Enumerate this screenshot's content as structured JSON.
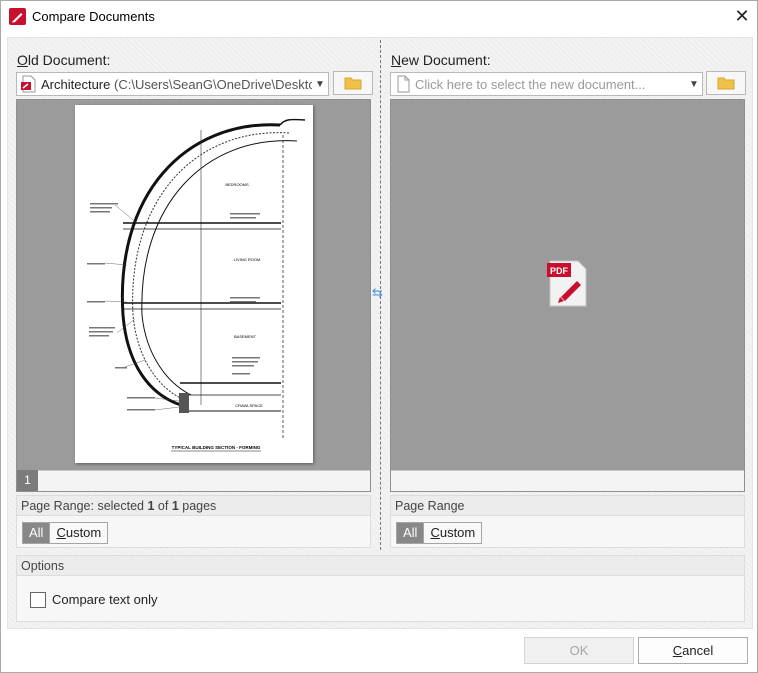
{
  "window": {
    "title": "Compare Documents"
  },
  "old_doc": {
    "label_pre": "O",
    "label_rest": "ld Document:",
    "file_name": "Architecture",
    "file_path": "(C:\\Users\\SeanG\\OneDrive\\Desktop\\W",
    "page_number": "1",
    "range_prefix": "Page Range: selected ",
    "range_selected": "1",
    "range_of": " of ",
    "range_total": "1",
    "range_suffix": " pages",
    "all_label": "All",
    "custom_pre": "C",
    "custom_rest": "ustom"
  },
  "new_doc": {
    "label_pre": "N",
    "label_rest": "ew Document:",
    "placeholder": "Click here to select the new document...",
    "range_label": "Page Range",
    "all_label": "All",
    "custom_pre": "C",
    "custom_rest": "ustom",
    "pdf_icon_text": "PDF"
  },
  "drawing": {
    "room_1": "BEDROOMS",
    "room_2": "LIVING ROOM",
    "room_3": "BASEMENT",
    "room_4": "CRAWLSPACE",
    "section_title": "TYPICAL BUILDING SECTION - FORMING"
  },
  "options": {
    "header": "Options",
    "compare_text_only": "Compare text only"
  },
  "buttons": {
    "ok_label": "OK",
    "cancel_pre": "C",
    "cancel_rest": "ancel"
  },
  "colors": {
    "accent_red": "#c8102e",
    "folder_yellow": "#f0c14a",
    "swap_blue": "#4a90d9"
  }
}
